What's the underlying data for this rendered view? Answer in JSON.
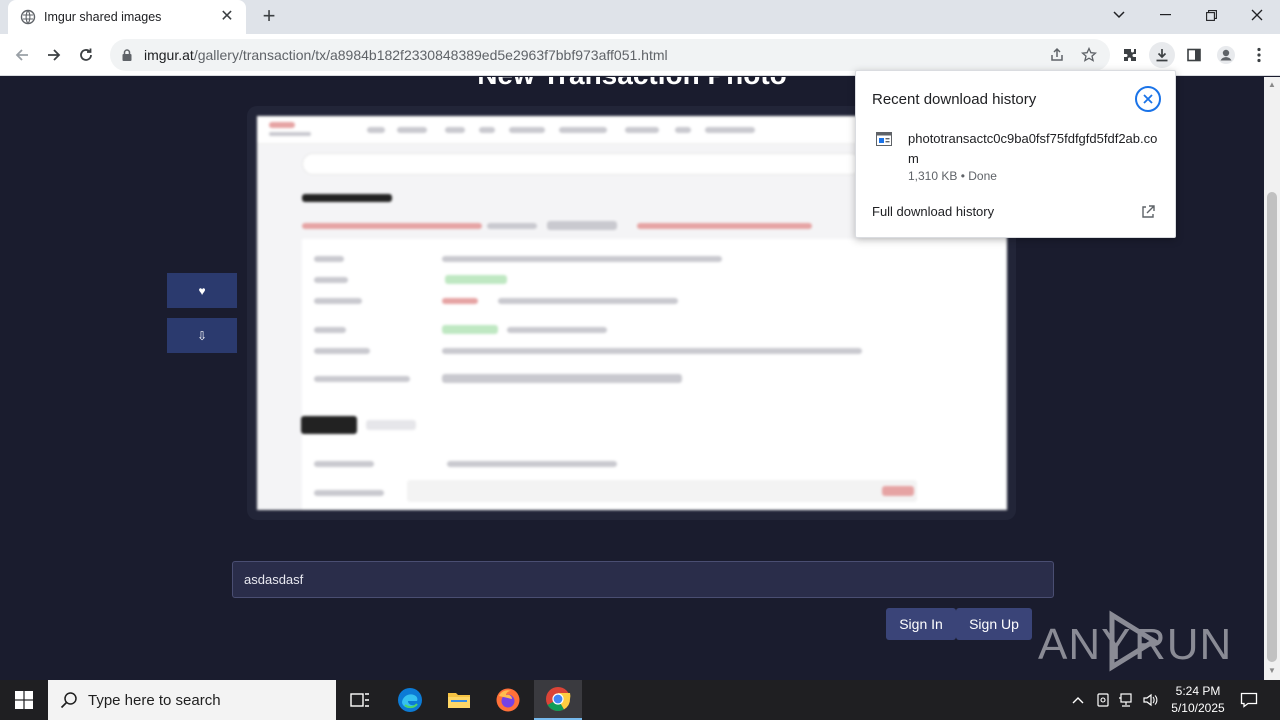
{
  "browser": {
    "tab_title": "Imgur shared images",
    "url_host": "imgur.at",
    "url_path": "/gallery/transaction/tx/a8984b182f2330848389ed5e2963f7bbf973aff051.html"
  },
  "page": {
    "heading": "New Transaction Photo",
    "like_label": "♥",
    "download_label": "⇩",
    "input_value": "asdasdasf",
    "sign_in_label": "Sign In",
    "sign_up_label": "Sign Up",
    "watermark": "ANY RUN"
  },
  "downloads": {
    "title": "Recent download history",
    "filename": "phototransactc0c9ba0fsf75fdfgfd5fdf2ab.com",
    "status": "1,310 KB • Done",
    "full_history_label": "Full download history"
  },
  "taskbar": {
    "search_placeholder": "Type here to search",
    "time": "5:24 PM",
    "date": "5/10/2025"
  },
  "colors": {
    "page_bg": "#1a1c2e",
    "button_bg": "#2b3a6e",
    "accent_blue": "#1a73e8"
  }
}
